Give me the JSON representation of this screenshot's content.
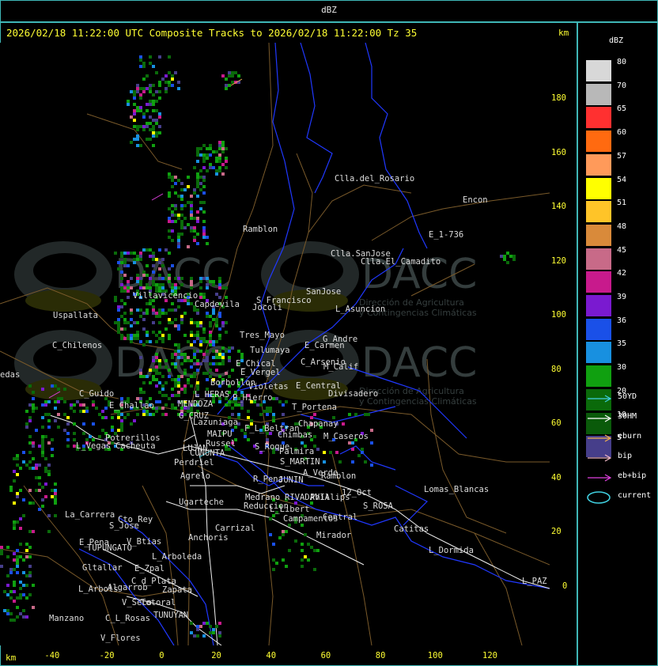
{
  "header": {
    "title": "dBZ"
  },
  "status_line": "2026/02/18 11:22:00 UTC Composite Tracks to 2026/02/18 11:22:00 Tz 35",
  "axis": {
    "unit_top": "km",
    "unit_bottom": "km",
    "y_ticks": [
      "180",
      "160",
      "140",
      "120",
      "100",
      "80",
      "60",
      "40",
      "20",
      "0"
    ],
    "x_ticks": [
      "-40",
      "-20",
      "0",
      "20",
      "40",
      "60",
      "80",
      "100",
      "120"
    ]
  },
  "legend": {
    "title": "dBZ",
    "bins": [
      {
        "label": "80",
        "color": "#d8d8d8"
      },
      {
        "label": "70",
        "color": "#b8b8b8"
      },
      {
        "label": "65",
        "color": "#ff3030"
      },
      {
        "label": "60",
        "color": "#ff6a10"
      },
      {
        "label": "57",
        "color": "#ff9a5a"
      },
      {
        "label": "54",
        "color": "#ffff00"
      },
      {
        "label": "51",
        "color": "#ffc428"
      },
      {
        "label": "48",
        "color": "#d98a3a"
      },
      {
        "label": "45",
        "color": "#c86a88"
      },
      {
        "label": "42",
        "color": "#c81a8c"
      },
      {
        "label": "39",
        "color": "#7a1ad0"
      },
      {
        "label": "36",
        "color": "#1a50e8"
      },
      {
        "label": "35",
        "color": "#1890e0"
      },
      {
        "label": "30",
        "color": "#10a010"
      },
      {
        "label": "20",
        "color": "#0a6a0a"
      },
      {
        "label": "10",
        "color": "#0a5a0a"
      },
      {
        "label": "5",
        "color": "#463e8a"
      }
    ],
    "tracks": [
      {
        "label": "50YD",
        "color": "#40d0e0"
      },
      {
        "label": "30HM",
        "color": "#ffffff"
      },
      {
        "label": "eburn",
        "color": "#f0b050"
      },
      {
        "label": "bip",
        "color": "#f0b8c8"
      },
      {
        "label": "eb+bip",
        "color": "#e040e0"
      },
      {
        "label": "current",
        "color": "#40d0e0"
      }
    ]
  },
  "watermark": {
    "brand": "DACC",
    "line1": "Dirección de Agricultura",
    "line2": "y Contingencias Climáticas"
  },
  "places": [
    "Clla.del_Rosario",
    "Encon",
    "E_1-736",
    "Ramblon",
    "Clla.SanJose",
    "Clla.El_Camadito",
    "Uspallata",
    "Villavicencio",
    "Capdevila",
    "S_Francisco",
    "SanJose",
    "L_Asuncion",
    "C_Chilenos",
    "Jocoli",
    "Tres_Mayo",
    "Tulumaya",
    "G_Andre",
    "E_Carmen",
    "C_Arsenio",
    "M_Calif",
    "E_Chical",
    "E_Vergel",
    "Borbollon",
    "L_HERAS",
    "P_Hierro",
    "Violetas",
    "E_Central",
    "Divisadero",
    "edas",
    "C_Guido",
    "E_Challao",
    "MENDOZA",
    "G_CRUZ",
    "Lazuniaga",
    "T_Portena",
    "Chapanay",
    "F_L_Beltran",
    "Chimbas",
    "M_Caseros",
    "MAIPU",
    "Russel",
    "S_Roque",
    "Potrerillos",
    "L_Vegas",
    "Cacheuta",
    "LUJAN",
    "CUNUNTA",
    "Palmira",
    "S_MARTIN",
    "Perdriel",
    "A_Verde",
    "Ramblon",
    "Agrelo",
    "R_Pena",
    "JUNIN",
    "Ugarteche",
    "Medrano",
    "RIVADAVIA",
    "Phillips",
    "12_Oct",
    "Lomas_Blancas",
    "S_ROSA",
    "La_Carrera",
    "Cto_Rey",
    "S_Jose",
    "Reduccion",
    "L_Libert",
    "Carrizal",
    "Campamentos",
    "Central",
    "Catitas",
    "E_Pena",
    "V_Btias",
    "Anchoris",
    "TUPUNGATO",
    "L_Arboleda",
    "Mirador",
    "L_Dormida",
    "Gltallar",
    "E_Zpal",
    "C_d_Plata",
    "L_Arbols",
    "Zapata",
    "L_PAZ",
    "Algarrob",
    "V_Seco",
    "Totoral",
    "TUNUYAN",
    "Manzano",
    "C_L_Rosas",
    "V_Flores"
  ]
}
